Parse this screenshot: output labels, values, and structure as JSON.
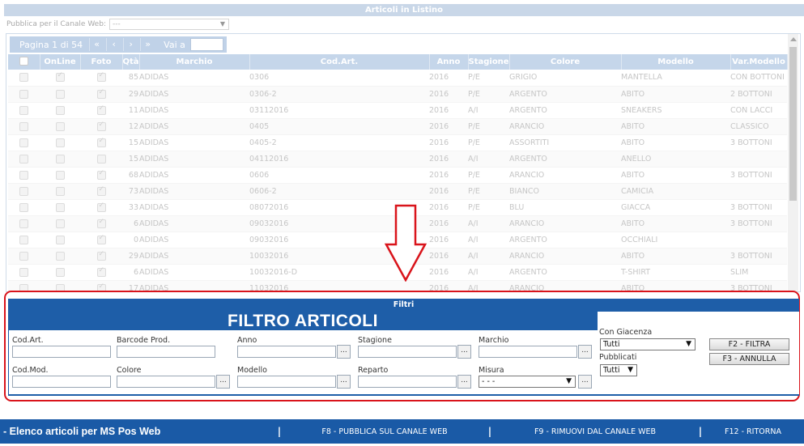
{
  "window": {
    "title": "Articoli in Listino"
  },
  "canale": {
    "label": "Pubblica per il Canale Web:",
    "value": "---"
  },
  "pager": {
    "page_label": "Pagina 1 di 54",
    "first": "«",
    "prev": "‹",
    "next": "›",
    "last": "»",
    "goto_label": "Vai a",
    "goto_value": ""
  },
  "grid": {
    "columns": [
      "",
      "OnLine",
      "Foto",
      "Qtà",
      "Marchio",
      "Cod.Art.",
      "Anno",
      "Stagione",
      "Colore",
      "Modello",
      "Var.Modello"
    ],
    "rows": [
      {
        "online": true,
        "foto": true,
        "qta": "85",
        "marchio": "ADIDAS",
        "cod": "0306",
        "anno": "2016",
        "stagione": "P/E",
        "colore": "GRIGIO",
        "modello": "MANTELLA",
        "var": "CON BOTTONI"
      },
      {
        "online": false,
        "foto": true,
        "qta": "29",
        "marchio": "ADIDAS",
        "cod": "0306-2",
        "anno": "2016",
        "stagione": "P/E",
        "colore": "ARGENTO",
        "modello": "ABITO",
        "var": "2 BOTTONI"
      },
      {
        "online": false,
        "foto": true,
        "qta": "11",
        "marchio": "ADIDAS",
        "cod": "03112016",
        "anno": "2016",
        "stagione": "A/I",
        "colore": "ARGENTO",
        "modello": "SNEAKERS",
        "var": "CON LACCI"
      },
      {
        "online": false,
        "foto": true,
        "qta": "12",
        "marchio": "ADIDAS",
        "cod": "0405",
        "anno": "2016",
        "stagione": "P/E",
        "colore": "ARANCIO",
        "modello": "ABITO",
        "var": "CLASSICO"
      },
      {
        "online": false,
        "foto": true,
        "qta": "15",
        "marchio": "ADIDAS",
        "cod": "0405-2",
        "anno": "2016",
        "stagione": "P/E",
        "colore": "ASSORTITI",
        "modello": "ABITO",
        "var": "3 BOTTONI"
      },
      {
        "online": false,
        "foto": false,
        "qta": "15",
        "marchio": "ADIDAS",
        "cod": "04112016",
        "anno": "2016",
        "stagione": "A/I",
        "colore": "ARGENTO",
        "modello": "ANELLO",
        "var": ""
      },
      {
        "online": false,
        "foto": true,
        "qta": "68",
        "marchio": "ADIDAS",
        "cod": "0606",
        "anno": "2016",
        "stagione": "P/E",
        "colore": "ARANCIO",
        "modello": "ABITO",
        "var": "3 BOTTONI"
      },
      {
        "online": false,
        "foto": true,
        "qta": "73",
        "marchio": "ADIDAS",
        "cod": "0606-2",
        "anno": "2016",
        "stagione": "P/E",
        "colore": "BIANCO",
        "modello": "CAMICIA",
        "var": ""
      },
      {
        "online": false,
        "foto": true,
        "qta": "33",
        "marchio": "ADIDAS",
        "cod": "08072016",
        "anno": "2016",
        "stagione": "P/E",
        "colore": "BLU",
        "modello": "GIACCA",
        "var": "3 BOTTONI"
      },
      {
        "online": false,
        "foto": true,
        "qta": "6",
        "marchio": "ADIDAS",
        "cod": "09032016",
        "anno": "2016",
        "stagione": "A/I",
        "colore": "ARANCIO",
        "modello": "ABITO",
        "var": "3 BOTTONI"
      },
      {
        "online": false,
        "foto": true,
        "qta": "0",
        "marchio": "ADIDAS",
        "cod": "09032016",
        "anno": "2016",
        "stagione": "A/I",
        "colore": "ARGENTO",
        "modello": "OCCHIALI",
        "var": ""
      },
      {
        "online": false,
        "foto": true,
        "qta": "29",
        "marchio": "ADIDAS",
        "cod": "10032016",
        "anno": "2016",
        "stagione": "A/I",
        "colore": "ARANCIO",
        "modello": "ABITO",
        "var": "3 BOTTONI"
      },
      {
        "online": false,
        "foto": true,
        "qta": "6",
        "marchio": "ADIDAS",
        "cod": "10032016-D",
        "anno": "2016",
        "stagione": "A/I",
        "colore": "ARGENTO",
        "modello": "T-SHIRT",
        "var": "SLIM"
      },
      {
        "online": false,
        "foto": true,
        "qta": "17",
        "marchio": "ADIDAS",
        "cod": "11032016",
        "anno": "2016",
        "stagione": "A/I",
        "colore": "ARANCIO",
        "modello": "ABITO",
        "var": "3 BOTTONI"
      }
    ]
  },
  "filtri": {
    "header": "Filtri",
    "title": "FILTRO ARTICOLI",
    "cod_art": {
      "label": "Cod.Art.",
      "value": ""
    },
    "barcode": {
      "label": "Barcode Prod.",
      "value": ""
    },
    "anno": {
      "label": "Anno",
      "value": ""
    },
    "stagione": {
      "label": "Stagione",
      "value": ""
    },
    "marchio": {
      "label": "Marchio",
      "value": ""
    },
    "cod_mod": {
      "label": "Cod.Mod.",
      "value": ""
    },
    "colore": {
      "label": "Colore",
      "value": ""
    },
    "modello": {
      "label": "Modello",
      "value": ""
    },
    "reparto": {
      "label": "Reparto",
      "value": ""
    },
    "misura": {
      "label": "Misura",
      "value": "- - -"
    },
    "con_giacenza": {
      "label": "Con Giacenza",
      "value": "Tutti"
    },
    "pubblicati": {
      "label": "Pubblicati",
      "value": "Tutti"
    },
    "lookup_glyph": "...",
    "filtra_button": "F2 - FILTRA",
    "annulla_button": "F3 - ANNULLA"
  },
  "bottom_bar": {
    "title": "- Elenco articoli per MS Pos Web",
    "separator": "|",
    "pubblica": "F8 - PUBBLICA SUL CANALE WEB",
    "rimuovi": "F9 - RIMUOVI DAL CANALE WEB",
    "ritorna": "F12 - RITORNA"
  },
  "colors": {
    "accent": "#1e5ea8",
    "highlight": "#d9141b",
    "header_bg": "#c5d6ea"
  }
}
